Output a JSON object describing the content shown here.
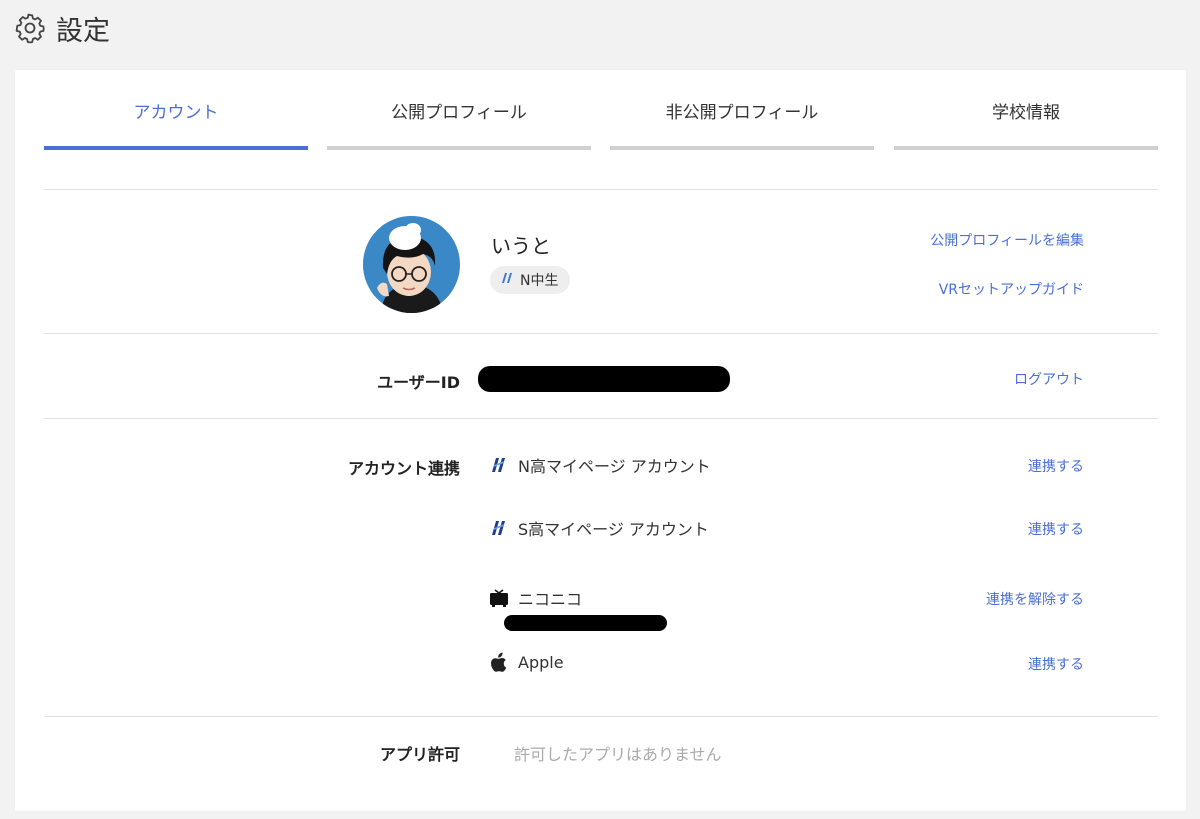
{
  "header": {
    "title": "設定",
    "icon": "gear-icon"
  },
  "tabs": [
    {
      "label": "アカウント",
      "active": true
    },
    {
      "label": "公開プロフィール",
      "active": false
    },
    {
      "label": "非公開プロフィール",
      "active": false
    },
    {
      "label": "学校情報",
      "active": false
    }
  ],
  "profile": {
    "name": "いうと",
    "badge": "N中生",
    "links": {
      "edit_profile": "公開プロフィールを編集",
      "vr_guide": "VRセットアップガイド"
    }
  },
  "user_id": {
    "label": "ユーザーID",
    "logout": "ログアウト"
  },
  "account_links": {
    "label": "アカウント連携",
    "services": [
      {
        "name": "N高マイページ アカウント",
        "icon": "n-school-logo-icon",
        "action": "連携する"
      },
      {
        "name": "S高マイページ アカウント",
        "icon": "s-school-logo-icon",
        "action": "連携する"
      },
      {
        "name": "ニコニコ",
        "icon": "niconico-tv-icon",
        "action": "連携を解除する"
      },
      {
        "name": "Apple",
        "icon": "apple-icon",
        "action": "連携する"
      }
    ]
  },
  "app_permissions": {
    "label": "アプリ許可",
    "empty": "許可したアプリはありません"
  },
  "colors": {
    "accent": "#4a6fd6",
    "inactive_tab_bar": "#d0d0d0",
    "page_bg": "#f2f2f2"
  }
}
